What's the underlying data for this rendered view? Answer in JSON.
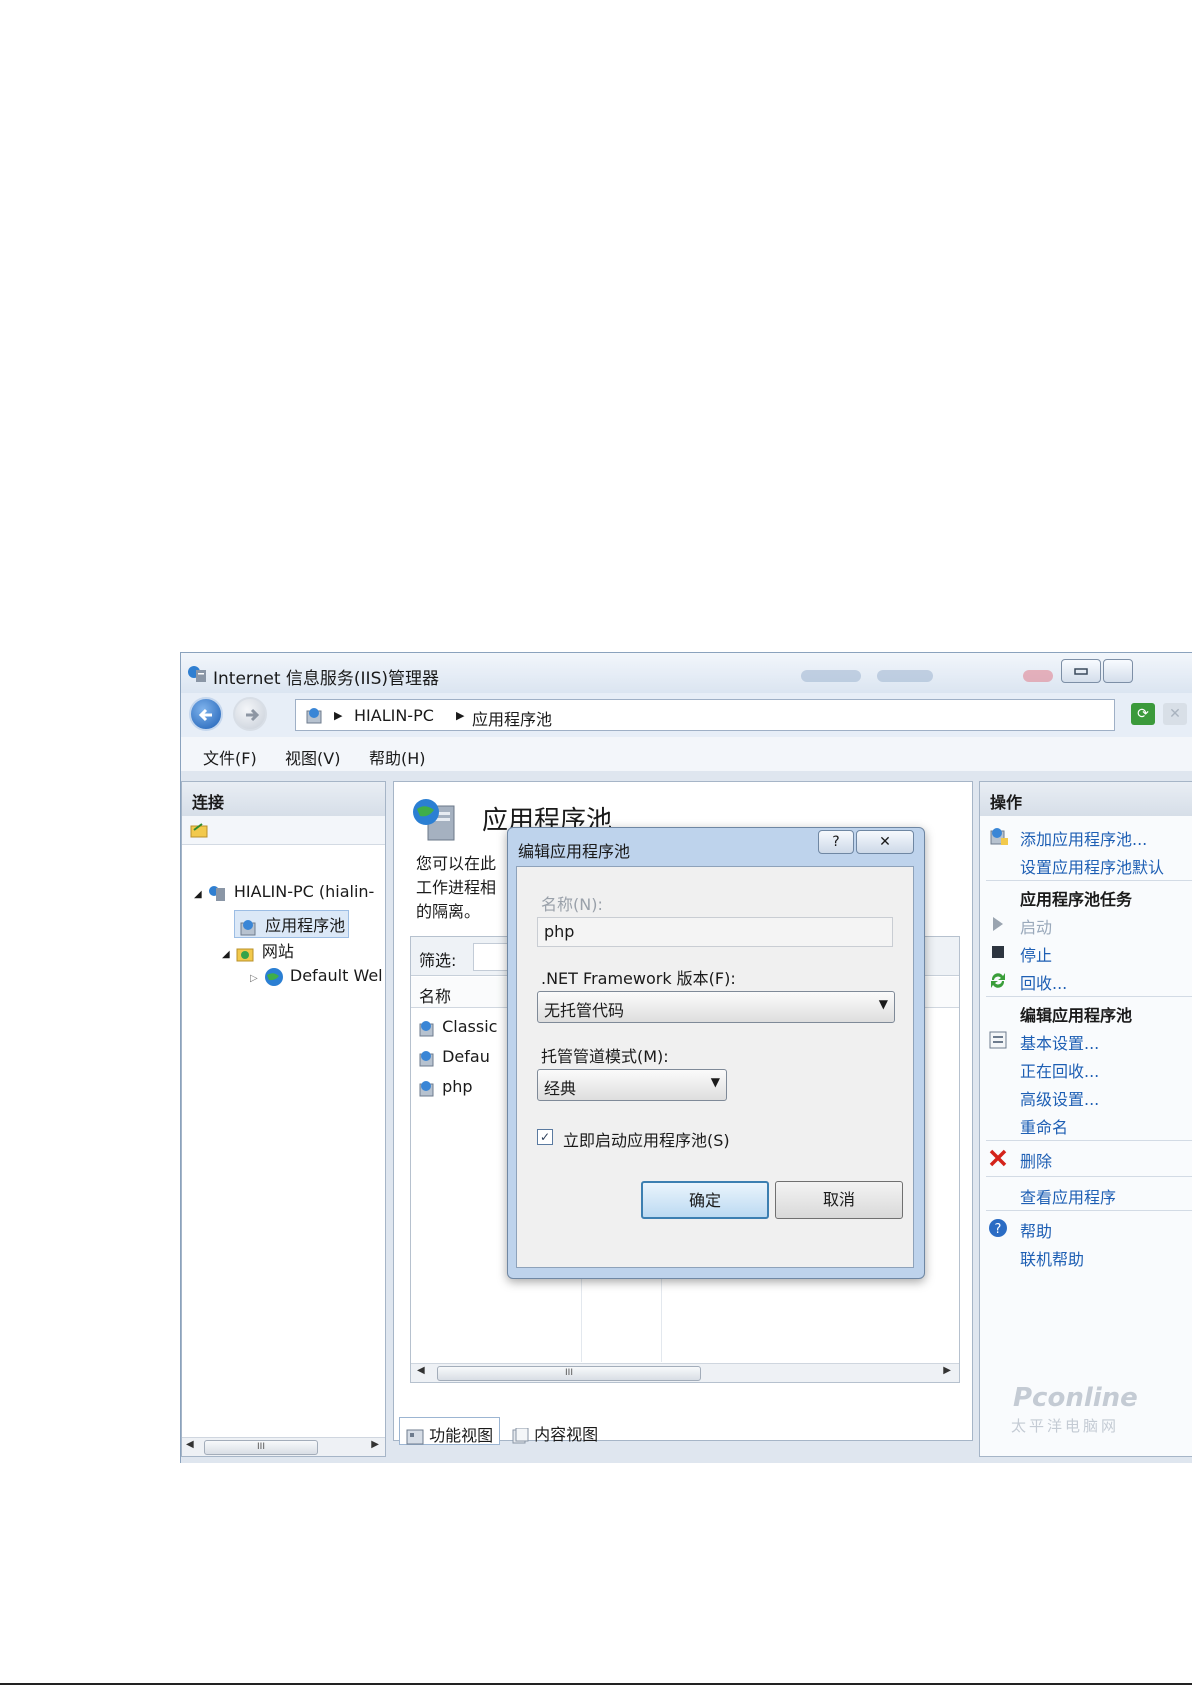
{
  "window": {
    "title": "Internet 信息服务(IIS)管理器"
  },
  "address": {
    "crumbs": [
      "HIALIN-PC",
      "应用程序池"
    ]
  },
  "menu": {
    "items": [
      "文件(F)",
      "视图(V)",
      "帮助(H)"
    ]
  },
  "connections": {
    "header": "连接",
    "tree": [
      {
        "label": "HIALIN-PC (hialin-"
      },
      {
        "label": "应用程序池"
      },
      {
        "label": "网站"
      },
      {
        "label": "Default Wel"
      }
    ]
  },
  "center": {
    "title": "应用程序池",
    "desc_lines": [
      "您可以在此",
      "工作进程相",
      "的隔离。"
    ],
    "filter_label": "筛选:",
    "column_name": "名称",
    "rows": [
      "Classic",
      "Defau",
      "php"
    ],
    "tabs": [
      "功能视图",
      "内容视图"
    ]
  },
  "actions": {
    "header": "操作",
    "add_pool": "添加应用程序池...",
    "set_defaults": "设置应用程序池默认",
    "tasks_header": "应用程序池任务",
    "start": "启动",
    "stop": "停止",
    "recycle": "回收...",
    "edit_header": "编辑应用程序池",
    "basic_settings": "基本设置...",
    "recycling": "正在回收...",
    "advanced": "高级设置...",
    "rename": "重命名",
    "delete": "删除",
    "view_apps": "查看应用程序",
    "help": "帮助",
    "online_help": "联机帮助"
  },
  "dialog": {
    "title": "编辑应用程序池",
    "help_glyph": "?",
    "close_glyph": "✕",
    "name_label": "名称(N):",
    "name_value": "php",
    "framework_label": ".NET Framework 版本(F):",
    "framework_value": "无托管代码",
    "pipeline_label": "托管管道模式(M):",
    "pipeline_value": "经典",
    "start_label": "立即启动应用程序池(S)",
    "start_checked": true,
    "ok": "确定",
    "cancel": "取消"
  },
  "watermark": {
    "brand": "Pconline",
    "sub": "太平洋电脑网"
  }
}
